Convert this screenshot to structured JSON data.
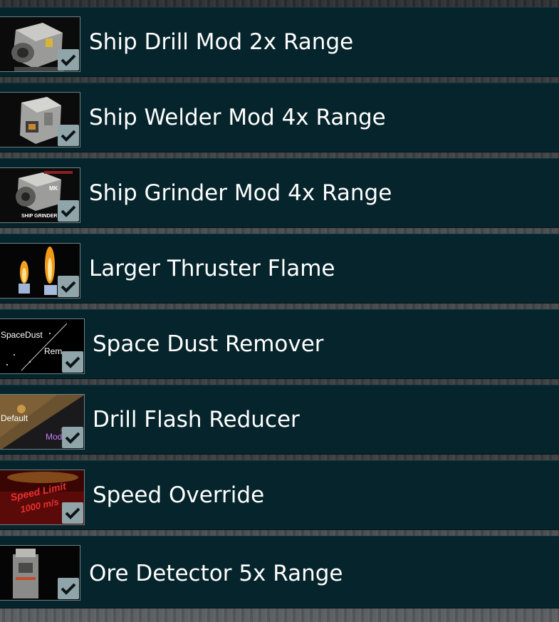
{
  "mods": [
    {
      "label": "Ship Drill Mod 2x Range",
      "icon": "drill-mod-icon",
      "checked": true,
      "thumb_text": []
    },
    {
      "label": "Ship Welder Mod 4x Range",
      "icon": "welder-mod-icon",
      "checked": true,
      "thumb_text": []
    },
    {
      "label": "Ship Grinder Mod 4x Range",
      "icon": "grinder-mod-icon",
      "checked": true,
      "thumb_text": [
        "MK",
        "SHIP GRINDER"
      ]
    },
    {
      "label": "Larger Thruster Flame",
      "icon": "thruster-flame-icon",
      "checked": true,
      "thumb_text": []
    },
    {
      "label": "Space Dust Remover",
      "icon": "space-dust-icon",
      "checked": true,
      "thumb_text": [
        "SpaceDust",
        "Rem"
      ]
    },
    {
      "label": "Drill Flash Reducer",
      "icon": "drill-flash-icon",
      "checked": true,
      "thumb_text": [
        "Default",
        "Mod"
      ]
    },
    {
      "label": "Speed Override",
      "icon": "speed-limit-icon",
      "checked": true,
      "thumb_text": [
        "Speed Limit",
        "1000 m/s"
      ]
    },
    {
      "label": "Ore Detector 5x Range",
      "icon": "ore-detector-icon",
      "checked": true,
      "thumb_text": []
    }
  ],
  "colors": {
    "row_bg": "#06242b",
    "check_bg": "#8fa5a9",
    "text": "#ffffff"
  }
}
